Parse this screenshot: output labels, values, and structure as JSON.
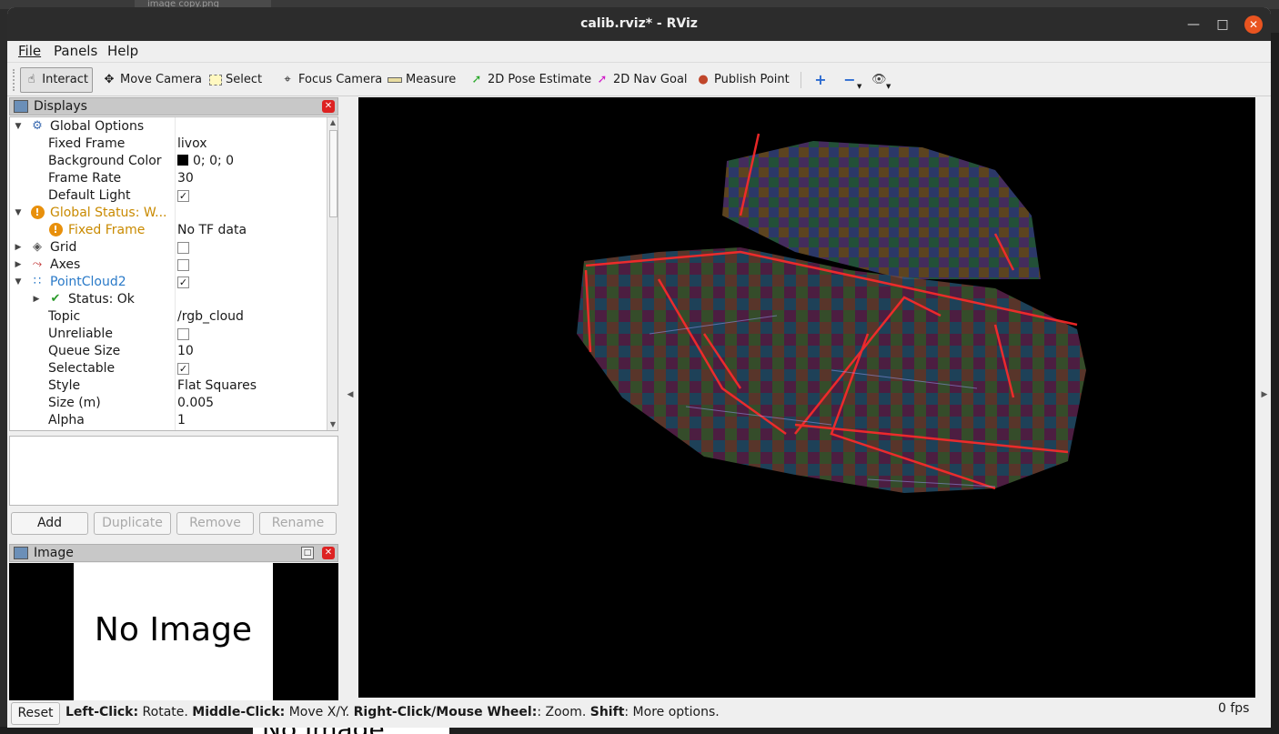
{
  "window": {
    "title": "calib.rviz* - RViz"
  },
  "background": {
    "tab_label": "image copy.png",
    "noimage_fragment": "No Image"
  },
  "menu": {
    "file": "File",
    "panels": "Panels",
    "help": "Help"
  },
  "toolbar": {
    "interact": "Interact",
    "move_camera": "Move Camera",
    "select": "Select",
    "focus_camera": "Focus Camera",
    "measure": "Measure",
    "pose_estimate": "2D Pose Estimate",
    "nav_goal": "2D Nav Goal",
    "publish_point": "Publish Point"
  },
  "displays": {
    "title": "Displays",
    "rows": [
      {
        "key": "Global Options"
      },
      {
        "key": "Fixed Frame",
        "value": "livox"
      },
      {
        "key": "Background Color",
        "value": "0; 0; 0"
      },
      {
        "key": "Frame Rate",
        "value": "30"
      },
      {
        "key": "Default Light",
        "checked": true
      },
      {
        "key": "Global Status: W..."
      },
      {
        "key": "Fixed Frame",
        "value": "No TF data"
      },
      {
        "key": "Grid",
        "checked": false
      },
      {
        "key": "Axes",
        "checked": false
      },
      {
        "key": "PointCloud2",
        "checked": true
      },
      {
        "key": "Status: Ok"
      },
      {
        "key": "Topic",
        "value": "/rgb_cloud"
      },
      {
        "key": "Unreliable",
        "checked": false
      },
      {
        "key": "Queue Size",
        "value": "10"
      },
      {
        "key": "Selectable",
        "checked": true
      },
      {
        "key": "Style",
        "value": "Flat Squares"
      },
      {
        "key": "Size (m)",
        "value": "0.005"
      },
      {
        "key": "Alpha",
        "value": "1"
      }
    ],
    "buttons": {
      "add": "Add",
      "duplicate": "Duplicate",
      "remove": "Remove",
      "rename": "Rename"
    }
  },
  "image_panel": {
    "title": "Image",
    "placeholder": "No Image"
  },
  "status": {
    "reset": "Reset",
    "h1b": "Left-Click:",
    "h1": " Rotate. ",
    "h2b": "Middle-Click:",
    "h2": " Move X/Y. ",
    "h3b": "Right-Click/Mouse Wheel:",
    "h3": ": Zoom. ",
    "h4b": "Shift",
    "h4": ": More options.",
    "fps": "0 fps"
  },
  "colors": {
    "accent_warning": "#c98a00",
    "selected_display": "#2a7ac8",
    "close_button": "#e95420"
  }
}
